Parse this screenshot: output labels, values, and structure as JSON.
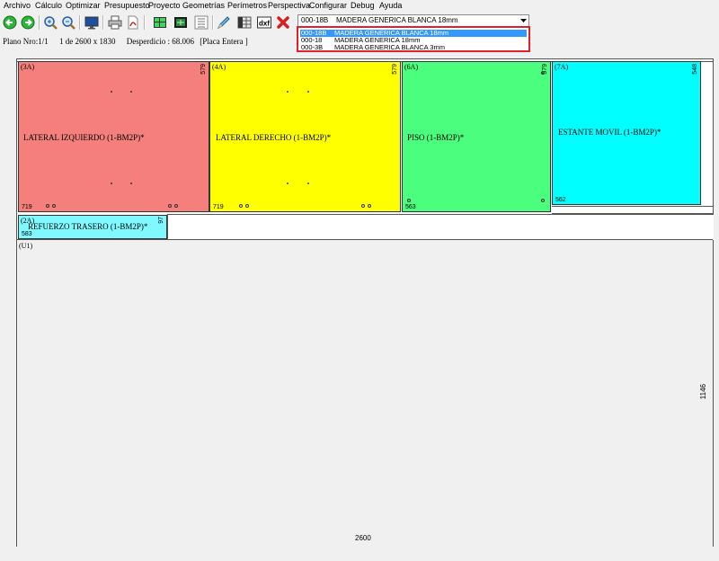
{
  "menu": [
    "Archivo",
    "Cálculo",
    "Optimizar",
    "Presupuesto",
    "Proyecto",
    "Geometrías",
    "Perímetros",
    "Perspectiva",
    "Configurar",
    "Debug",
    "Ayuda"
  ],
  "toolbar": {
    "icons": [
      "back-arrow-icon",
      "forward-arrow-icon",
      "zoom-in-icon",
      "zoom-out-icon",
      "monitor-icon",
      "print-icon",
      "pdf-icon",
      "layout-grid-icon",
      "chip-icon",
      "list-view-icon",
      "pencil-icon",
      "table-icon",
      "dxf-icon",
      "delete-icon"
    ],
    "dxf_label": "dxf",
    "material_select": {
      "selected_code": "000-18B",
      "selected_desc": "MADERA GENERICA BLANCA 18mm",
      "options": [
        {
          "code": "000-18B",
          "desc": "MADERA GENERICA BLANCA 18mm",
          "selected": true
        },
        {
          "code": "000-18",
          "desc": "MADERA GENERICA 18mm",
          "selected": false
        },
        {
          "code": "000-3B",
          "desc": "MADERA GENERICA BLANCA 3mm",
          "selected": false
        }
      ]
    }
  },
  "info": {
    "plano": "Plano Nro:1/1",
    "size": "1 de 2600 x 1830",
    "desperdicio": "Desperdicio : 68.006",
    "placa": "[Placa Entera  ]"
  },
  "colors": {
    "red": "#f47f7c",
    "yellow": "#ffff00",
    "green": "#4cfe7e",
    "cyan": "#00ffff",
    "lightcyan": "#7ff9ff",
    "remnant": "#f0f0f0"
  },
  "pieces": [
    {
      "id": "(3A)",
      "name": "LATERAL IZQUIERDO (1-BM2P)*",
      "height": "579",
      "width": "719"
    },
    {
      "id": "(4A)",
      "name": "LATERAL DERECHO (1-BM2P)*",
      "height": "579",
      "width": "719"
    },
    {
      "id": "(6A)",
      "name": "PISO (1-BM2P)*",
      "height": "579",
      "width": "563"
    },
    {
      "id": "(7A)",
      "name": "ESTANTE MOVIL (1-BM2P)*",
      "height": "548",
      "width": "562"
    },
    {
      "id": "(2A)",
      "name": "REFUERZO TRASERO (1-BM2P)*",
      "height": "97",
      "width": "583"
    }
  ],
  "remnant": {
    "id": "(U1)",
    "height": "1146",
    "width": "2600"
  }
}
